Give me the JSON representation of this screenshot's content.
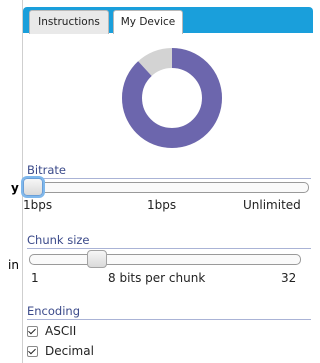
{
  "left_edge": {
    "fragment_1": "y",
    "fragment_2": "in"
  },
  "tabs": [
    {
      "label": "Instructions",
      "active": false
    },
    {
      "label": "My Device",
      "active": true
    }
  ],
  "colors": {
    "tab_bar": "#1a9fdb",
    "ring": "#6c66ad",
    "ring_track": "#d3d3d3",
    "section_label": "#3b4a8a"
  },
  "ring": {
    "fill_fraction": 0.88
  },
  "bitrate": {
    "label": "Bitrate",
    "value_fraction": 0.0,
    "min_label": "1bps",
    "current_label": "1bps",
    "max_label": "Unlimited"
  },
  "chunk_size": {
    "label": "Chunk size",
    "value_fraction": 0.23,
    "min_label": "1",
    "current_label": "8 bits per chunk",
    "max_label": "32"
  },
  "encoding": {
    "label": "Encoding",
    "options": [
      {
        "label": "ASCII",
        "checked": true
      },
      {
        "label": "Decimal",
        "checked": true
      }
    ]
  }
}
